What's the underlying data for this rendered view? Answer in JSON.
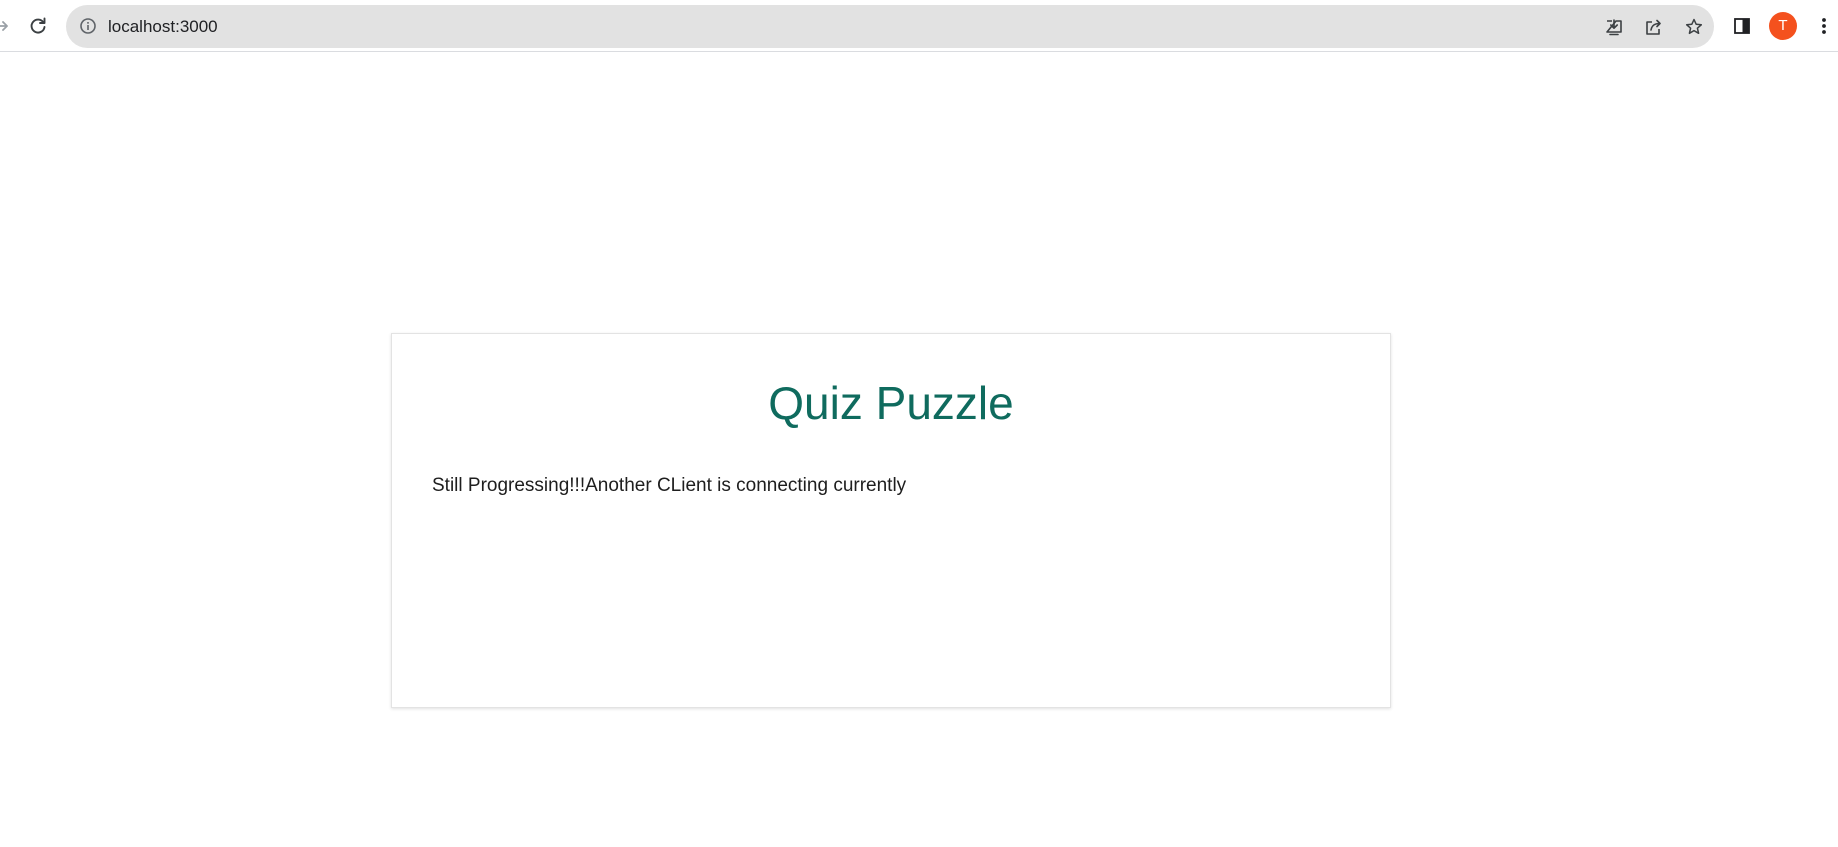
{
  "browser": {
    "url": "localhost:3000",
    "profile_initial": "T",
    "profile_color": "#f4511e",
    "icons": {
      "forward": "forward-arrow-icon",
      "reload": "reload-icon",
      "site_info": "info-icon",
      "install": "install-app-icon",
      "share": "share-icon",
      "bookmark": "star-icon",
      "side_panel": "side-panel-icon",
      "menu": "kebab-menu-icon"
    }
  },
  "page": {
    "title": "Quiz Puzzle",
    "title_color": "#0f6b5e",
    "message": "Still Progressing!!!Another CLient is connecting currently"
  }
}
